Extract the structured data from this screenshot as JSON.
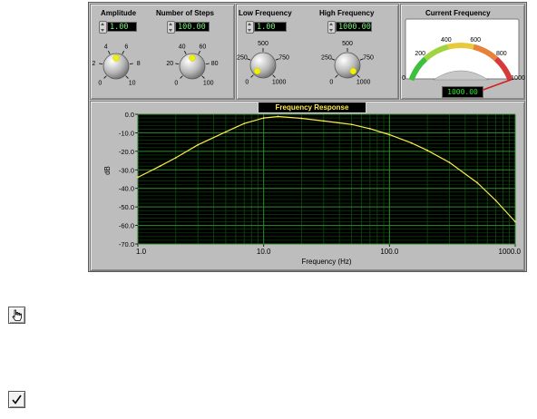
{
  "controls": {
    "amplitude": {
      "label": "Amplitude",
      "value": "1.00",
      "scale_labels": [
        "0",
        "2",
        "4",
        "6",
        "8",
        "10"
      ],
      "knob_value": 5
    },
    "num_steps": {
      "label": "Number of Steps",
      "value": "100.00",
      "scale_labels": [
        "0",
        "20",
        "40",
        "60",
        "80",
        "100"
      ],
      "knob_value": 50
    },
    "low_freq": {
      "label": "Low Frequency",
      "value": "1.00",
      "scale_labels": [
        "0",
        "250",
        "500",
        "750",
        "1000"
      ],
      "knob_value": 0
    },
    "high_freq": {
      "label": "High Frequency",
      "value": "1000.00",
      "scale_labels": [
        "0",
        "250",
        "500",
        "750",
        "1000"
      ],
      "knob_value": 1000
    }
  },
  "meter": {
    "label": "Current Frequency",
    "scale_labels": [
      "0",
      "200",
      "400",
      "600",
      "800",
      "1000"
    ],
    "value": 1000,
    "readout": "1000.00"
  },
  "graph": {
    "title": "Frequency Response",
    "xlabel": "Frequency (Hz)",
    "ylabel": "dB",
    "x_tick_labels": [
      "1.0",
      "10.0",
      "100.0",
      "1000.0"
    ],
    "y_tick_labels": [
      "0.0",
      "-10.0",
      "-20.0",
      "-30.0",
      "-40.0",
      "-50.0",
      "-60.0",
      "-70.0"
    ]
  },
  "chart_data": {
    "type": "line",
    "title": "Frequency Response",
    "xlabel": "Frequency (Hz)",
    "ylabel": "dB",
    "xscale": "log",
    "xlim": [
      1,
      1000
    ],
    "ylim": [
      -70,
      0
    ],
    "grid": true,
    "series": [
      {
        "color": "#ffe94a",
        "x": [
          1,
          1.5,
          2,
          3,
          5,
          7,
          10,
          13,
          20,
          30,
          50,
          70,
          100,
          150,
          200,
          300,
          500,
          700,
          1000
        ],
        "y": [
          -34,
          -28,
          -23.5,
          -16.5,
          -9.5,
          -5,
          -2,
          -1.2,
          -2.2,
          -3.6,
          -5.5,
          -7.8,
          -11,
          -15.5,
          -19.5,
          -26,
          -37,
          -46.5,
          -58
        ]
      }
    ]
  },
  "toolbar": {
    "operate_icon": "pointing-hand-icon",
    "check_icon": "checkmark-icon"
  }
}
